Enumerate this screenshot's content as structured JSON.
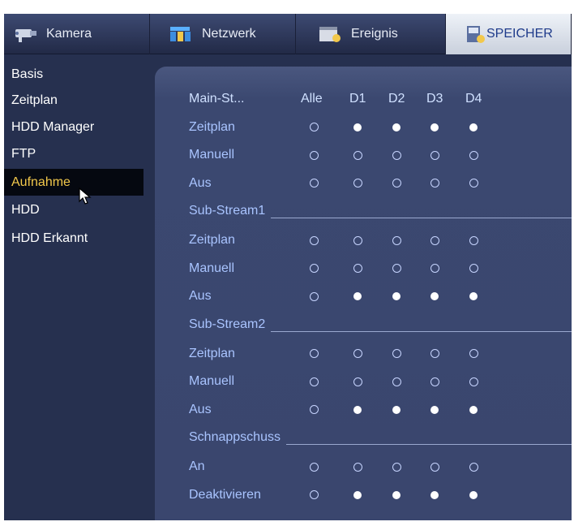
{
  "tabs": [
    {
      "label": "Kamera",
      "icon": "camera-icon"
    },
    {
      "label": "Netzwerk",
      "icon": "network-icon"
    },
    {
      "label": "Ereignis",
      "icon": "event-icon"
    },
    {
      "label": "SPEICHER",
      "icon": "storage-icon",
      "active": true
    }
  ],
  "sidebar": {
    "items": [
      {
        "label": "Basis"
      },
      {
        "label": "Zeitplan"
      },
      {
        "label": "HDD Manager"
      },
      {
        "label": "FTP"
      },
      {
        "label": "Aufnahme",
        "active": true
      },
      {
        "label": "HDD"
      },
      {
        "label": "HDD Erkannt"
      }
    ]
  },
  "record": {
    "header": {
      "stream": "Main-St...",
      "all": "Alle",
      "channels": [
        "D1",
        "D2",
        "D3",
        "D4"
      ]
    },
    "sections": [
      {
        "name": "",
        "rows": [
          {
            "label": "Zeitplan",
            "all": false,
            "channels": [
              true,
              true,
              true,
              true
            ]
          },
          {
            "label": "Manuell",
            "all": false,
            "channels": [
              false,
              false,
              false,
              false
            ]
          },
          {
            "label": "Aus",
            "all": false,
            "channels": [
              false,
              false,
              false,
              false
            ]
          }
        ]
      },
      {
        "name": "Sub-Stream1",
        "rows": [
          {
            "label": "Zeitplan",
            "all": false,
            "channels": [
              false,
              false,
              false,
              false
            ]
          },
          {
            "label": "Manuell",
            "all": false,
            "channels": [
              false,
              false,
              false,
              false
            ]
          },
          {
            "label": "Aus",
            "all": false,
            "channels": [
              true,
              true,
              true,
              true
            ]
          }
        ]
      },
      {
        "name": "Sub-Stream2",
        "rows": [
          {
            "label": "Zeitplan",
            "all": false,
            "channels": [
              false,
              false,
              false,
              false
            ]
          },
          {
            "label": "Manuell",
            "all": false,
            "channels": [
              false,
              false,
              false,
              false
            ]
          },
          {
            "label": "Aus",
            "all": false,
            "channels": [
              true,
              true,
              true,
              true
            ]
          }
        ]
      },
      {
        "name": "Schnappschuss",
        "rows": [
          {
            "label": "An",
            "all": false,
            "channels": [
              false,
              false,
              false,
              false
            ]
          },
          {
            "label": "Deaktivieren",
            "all": false,
            "channels": [
              true,
              true,
              true,
              true
            ]
          }
        ]
      }
    ]
  },
  "colors": {
    "accent": "#f2c84b",
    "background": "#26304f",
    "panel": "#3a466e",
    "tab_active_text": "#1e3a8a"
  }
}
